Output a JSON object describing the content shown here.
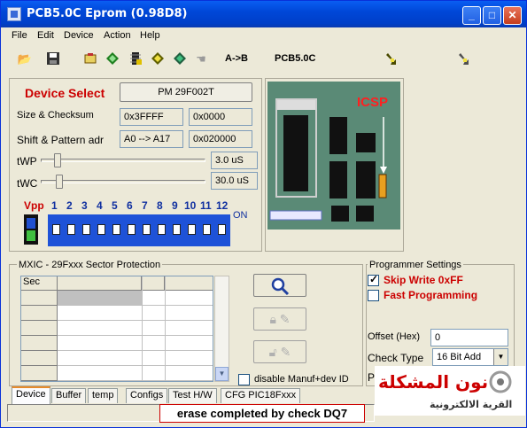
{
  "window": {
    "title": "PCB5.0C Eprom (0.98D8)",
    "min": "_",
    "max": "□",
    "close": "✕"
  },
  "menu": [
    "File",
    "Edit",
    "Device",
    "Action",
    "Help"
  ],
  "toolbar": {
    "ab_label": "A->B",
    "pcb_label": "PCB5.0C"
  },
  "device": {
    "select_label": "Device Select",
    "device_name": "PM 29F002T",
    "size_label": "Size & Checksum",
    "size_value": "0x3FFFF",
    "checksum_value": "0x0000",
    "shift_label": "Shift & Pattern adr",
    "shift_value": "A0 --> A17",
    "pattern_value": "0x020000",
    "twp_label": "tWP",
    "twp_value": "3.0 uS",
    "twc_label": "tWC",
    "twc_value": "30.0 uS",
    "vpp_label": "Vpp",
    "dip_numbers": [
      "1",
      "2",
      "3",
      "4",
      "5",
      "6",
      "7",
      "8",
      "9",
      "10",
      "11",
      "12"
    ],
    "on_label": "ON"
  },
  "board": {
    "icsp_label": "ICSP"
  },
  "sector": {
    "title": "MXIC - 29Fxxx Sector Protection",
    "col_header": "Sec",
    "disable_label": "disable Manuf+dev ID"
  },
  "programmer": {
    "title": "Programmer Settings",
    "skip_label": "Skip Write 0xFF",
    "skip_checked": true,
    "fast_label": "Fast Programming",
    "fast_checked": false,
    "offset_label": "Offset (Hex)",
    "offset_value": "0",
    "checktype_label": "Check Type",
    "checktype_value": "16 Bit Add",
    "partial_label": "P"
  },
  "tabs": [
    "Device",
    "Buffer",
    "temp",
    "Configs",
    "Test H/W",
    "CFG PIC18Fxxx"
  ],
  "status": {
    "message": "erase completed by check DQ7"
  },
  "watermark": {
    "line1": "نون المشكلة",
    "line2": "القرية الالكترونية"
  },
  "colors": {
    "accent_red": "#cc0000",
    "dip_blue": "#1e52d8",
    "title_blue": "#0047d8"
  }
}
